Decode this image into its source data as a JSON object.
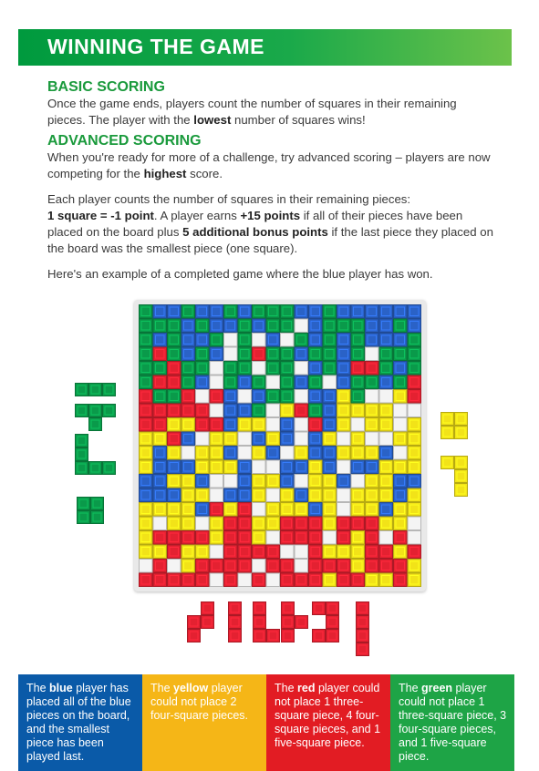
{
  "header": {
    "title": "WINNING THE GAME"
  },
  "basic": {
    "heading": "BASIC SCORING",
    "p1_a": "Once the game ends, players count the number of squares in their remaining pieces. The player with the ",
    "p1_b": "lowest",
    "p1_c": " number of squares wins!"
  },
  "advanced": {
    "heading": "ADVANCED SCORING",
    "p1_a": "When you're ready for more of a challenge, try advanced scoring – players are now competing for the ",
    "p1_b": "highest",
    "p1_c": " score.",
    "p2_a": "Each player counts the number of squares in their remaining pieces:",
    "p2_b": "1 square = -1 point",
    "p2_c": ". A player earns ",
    "p2_d": "+15 points",
    "p2_e": " if all of their pieces have been placed on the board plus ",
    "p2_f": "5 additional bonus points",
    "p2_g": " if the last piece they placed on the board was the smallest piece (one square).",
    "p3": "Here's an example of a completed game where the blue player has won."
  },
  "boxes": {
    "blue": {
      "a": "The ",
      "b": "blue",
      "c": " player has placed all of the blue pieces on the board, and the smallest piece has been played last."
    },
    "yellow": {
      "a": "The ",
      "b": "yellow",
      "c": " player could not place 2 four-square pieces."
    },
    "red": {
      "a": "The ",
      "b": "red",
      "c": " player could not place 1 three-square piece, 4 four-square pieces, and 1 five-square piece."
    },
    "green": {
      "a": "The ",
      "b": "green",
      "c": " player could not place 1 three-square piece, 3 four-square pieces, and 1 five-square piece."
    }
  },
  "colors": {
    "blue": "#2a62c7",
    "yellow": "#f2e318",
    "red": "#e42131",
    "green": "#0a9a4a",
    "empty": "#f4f4f4"
  }
}
